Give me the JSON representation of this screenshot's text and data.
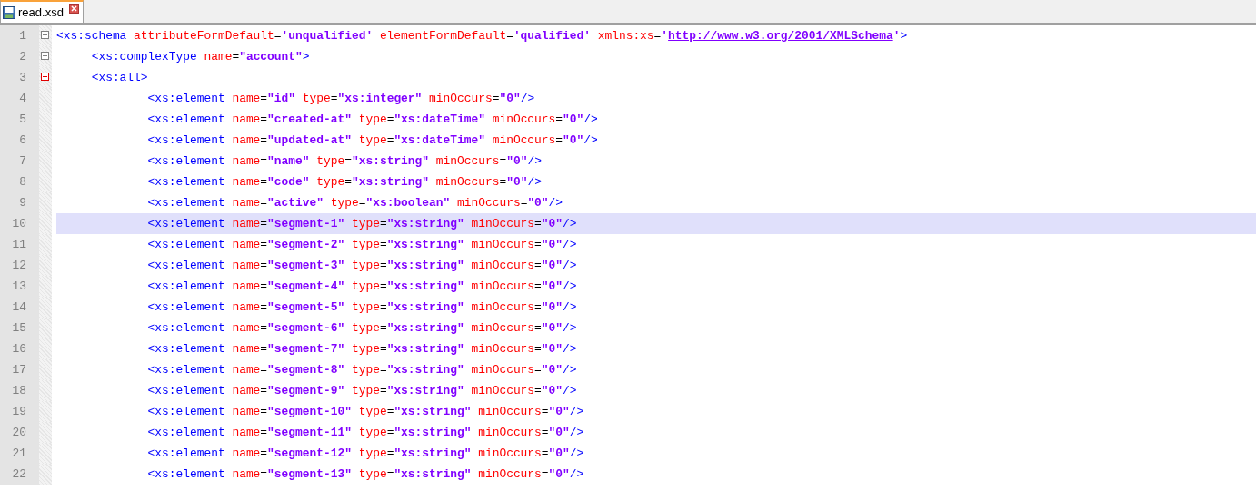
{
  "tabs": [
    {
      "label": "read.xsd",
      "selected": true
    }
  ],
  "lines": [
    {
      "number": "1",
      "kind": "fold_open",
      "selected": false,
      "tokens": [
        {
          "kind": "tag",
          "text": "<xs:schema "
        },
        {
          "kind": "attr",
          "text": "attributeFormDefault"
        },
        {
          "kind": "eq",
          "text": "="
        },
        {
          "kind": "value",
          "text": "'unqualified'"
        },
        {
          "kind": "attr",
          "text": " elementFormDefault"
        },
        {
          "kind": "eq",
          "text": "="
        },
        {
          "kind": "value",
          "text": "'qualified'"
        },
        {
          "kind": "attr",
          "text": " xmlns:xs"
        },
        {
          "kind": "eq",
          "text": "="
        },
        {
          "kind": "value",
          "text": "'"
        },
        {
          "kind": "link",
          "text": "http://www.w3.org/2001/XMLSchema"
        },
        {
          "kind": "value",
          "text": "'"
        },
        {
          "kind": "tag",
          "text": ">"
        }
      ]
    },
    {
      "number": "2",
      "kind": "fold_open",
      "selected": false,
      "tokens": [
        {
          "kind": "tag",
          "text": "     <xs:complexType "
        },
        {
          "kind": "attr",
          "text": "name"
        },
        {
          "kind": "eq",
          "text": "="
        },
        {
          "kind": "value",
          "text": "\"account\""
        },
        {
          "kind": "tag",
          "text": ">"
        }
      ]
    },
    {
      "number": "3",
      "kind": "fold_open_active",
      "selected": false,
      "tokens": [
        {
          "kind": "tag",
          "text": "     <xs:all>"
        }
      ]
    },
    {
      "number": "4",
      "kind": "fold_body",
      "selected": false,
      "tokens": [
        {
          "kind": "tag",
          "text": "             <xs:element "
        },
        {
          "kind": "attr",
          "text": "name"
        },
        {
          "kind": "eq",
          "text": "="
        },
        {
          "kind": "value",
          "text": "\"id\""
        },
        {
          "kind": "attr",
          "text": " type"
        },
        {
          "kind": "eq",
          "text": "="
        },
        {
          "kind": "value",
          "text": "\"xs:integer\""
        },
        {
          "kind": "attr",
          "text": " minOccurs"
        },
        {
          "kind": "eq",
          "text": "="
        },
        {
          "kind": "value",
          "text": "\"0\""
        },
        {
          "kind": "tag",
          "text": "/>"
        }
      ]
    },
    {
      "number": "5",
      "kind": "fold_body",
      "selected": false,
      "tokens": [
        {
          "kind": "tag",
          "text": "             <xs:element "
        },
        {
          "kind": "attr",
          "text": "name"
        },
        {
          "kind": "eq",
          "text": "="
        },
        {
          "kind": "value",
          "text": "\"created-at\""
        },
        {
          "kind": "attr",
          "text": " type"
        },
        {
          "kind": "eq",
          "text": "="
        },
        {
          "kind": "value",
          "text": "\"xs:dateTime\""
        },
        {
          "kind": "attr",
          "text": " minOccurs"
        },
        {
          "kind": "eq",
          "text": "="
        },
        {
          "kind": "value",
          "text": "\"0\""
        },
        {
          "kind": "tag",
          "text": "/>"
        }
      ]
    },
    {
      "number": "6",
      "kind": "fold_body",
      "selected": false,
      "tokens": [
        {
          "kind": "tag",
          "text": "             <xs:element "
        },
        {
          "kind": "attr",
          "text": "name"
        },
        {
          "kind": "eq",
          "text": "="
        },
        {
          "kind": "value",
          "text": "\"updated-at\""
        },
        {
          "kind": "attr",
          "text": " type"
        },
        {
          "kind": "eq",
          "text": "="
        },
        {
          "kind": "value",
          "text": "\"xs:dateTime\""
        },
        {
          "kind": "attr",
          "text": " minOccurs"
        },
        {
          "kind": "eq",
          "text": "="
        },
        {
          "kind": "value",
          "text": "\"0\""
        },
        {
          "kind": "tag",
          "text": "/>"
        }
      ]
    },
    {
      "number": "7",
      "kind": "fold_body",
      "selected": false,
      "tokens": [
        {
          "kind": "tag",
          "text": "             <xs:element "
        },
        {
          "kind": "attr",
          "text": "name"
        },
        {
          "kind": "eq",
          "text": "="
        },
        {
          "kind": "value",
          "text": "\"name\""
        },
        {
          "kind": "attr",
          "text": " type"
        },
        {
          "kind": "eq",
          "text": "="
        },
        {
          "kind": "value",
          "text": "\"xs:string\""
        },
        {
          "kind": "attr",
          "text": " minOccurs"
        },
        {
          "kind": "eq",
          "text": "="
        },
        {
          "kind": "value",
          "text": "\"0\""
        },
        {
          "kind": "tag",
          "text": "/>"
        }
      ]
    },
    {
      "number": "8",
      "kind": "fold_body",
      "selected": false,
      "tokens": [
        {
          "kind": "tag",
          "text": "             <xs:element "
        },
        {
          "kind": "attr",
          "text": "name"
        },
        {
          "kind": "eq",
          "text": "="
        },
        {
          "kind": "value",
          "text": "\"code\""
        },
        {
          "kind": "attr",
          "text": " type"
        },
        {
          "kind": "eq",
          "text": "="
        },
        {
          "kind": "value",
          "text": "\"xs:string\""
        },
        {
          "kind": "attr",
          "text": " minOccurs"
        },
        {
          "kind": "eq",
          "text": "="
        },
        {
          "kind": "value",
          "text": "\"0\""
        },
        {
          "kind": "tag",
          "text": "/>"
        }
      ]
    },
    {
      "number": "9",
      "kind": "fold_body",
      "selected": false,
      "tokens": [
        {
          "kind": "tag",
          "text": "             <xs:element "
        },
        {
          "kind": "attr",
          "text": "name"
        },
        {
          "kind": "eq",
          "text": "="
        },
        {
          "kind": "value",
          "text": "\"active\""
        },
        {
          "kind": "attr",
          "text": " type"
        },
        {
          "kind": "eq",
          "text": "="
        },
        {
          "kind": "value",
          "text": "\"xs:boolean\""
        },
        {
          "kind": "attr",
          "text": " minOccurs"
        },
        {
          "kind": "eq",
          "text": "="
        },
        {
          "kind": "value",
          "text": "\"0\""
        },
        {
          "kind": "tag",
          "text": "/>"
        }
      ]
    },
    {
      "number": "10",
      "kind": "fold_body",
      "selected": true,
      "tokens": [
        {
          "kind": "tag",
          "text": "             <xs:element "
        },
        {
          "kind": "attr",
          "text": "name"
        },
        {
          "kind": "eq",
          "text": "="
        },
        {
          "kind": "value",
          "text": "\"segment-1\""
        },
        {
          "kind": "attr",
          "text": " type"
        },
        {
          "kind": "eq",
          "text": "="
        },
        {
          "kind": "value",
          "text": "\"xs:string\""
        },
        {
          "kind": "attr",
          "text": " minOccurs"
        },
        {
          "kind": "eq",
          "text": "="
        },
        {
          "kind": "value",
          "text": "\"0\""
        },
        {
          "kind": "tag",
          "text": "/>"
        }
      ]
    },
    {
      "number": "11",
      "kind": "fold_body",
      "selected": false,
      "tokens": [
        {
          "kind": "tag",
          "text": "             <xs:element "
        },
        {
          "kind": "attr",
          "text": "name"
        },
        {
          "kind": "eq",
          "text": "="
        },
        {
          "kind": "value",
          "text": "\"segment-2\""
        },
        {
          "kind": "attr",
          "text": " type"
        },
        {
          "kind": "eq",
          "text": "="
        },
        {
          "kind": "value",
          "text": "\"xs:string\""
        },
        {
          "kind": "attr",
          "text": " minOccurs"
        },
        {
          "kind": "eq",
          "text": "="
        },
        {
          "kind": "value",
          "text": "\"0\""
        },
        {
          "kind": "tag",
          "text": "/>"
        }
      ]
    },
    {
      "number": "12",
      "kind": "fold_body",
      "selected": false,
      "tokens": [
        {
          "kind": "tag",
          "text": "             <xs:element "
        },
        {
          "kind": "attr",
          "text": "name"
        },
        {
          "kind": "eq",
          "text": "="
        },
        {
          "kind": "value",
          "text": "\"segment-3\""
        },
        {
          "kind": "attr",
          "text": " type"
        },
        {
          "kind": "eq",
          "text": "="
        },
        {
          "kind": "value",
          "text": "\"xs:string\""
        },
        {
          "kind": "attr",
          "text": " minOccurs"
        },
        {
          "kind": "eq",
          "text": "="
        },
        {
          "kind": "value",
          "text": "\"0\""
        },
        {
          "kind": "tag",
          "text": "/>"
        }
      ]
    },
    {
      "number": "13",
      "kind": "fold_body",
      "selected": false,
      "tokens": [
        {
          "kind": "tag",
          "text": "             <xs:element "
        },
        {
          "kind": "attr",
          "text": "name"
        },
        {
          "kind": "eq",
          "text": "="
        },
        {
          "kind": "value",
          "text": "\"segment-4\""
        },
        {
          "kind": "attr",
          "text": " type"
        },
        {
          "kind": "eq",
          "text": "="
        },
        {
          "kind": "value",
          "text": "\"xs:string\""
        },
        {
          "kind": "attr",
          "text": " minOccurs"
        },
        {
          "kind": "eq",
          "text": "="
        },
        {
          "kind": "value",
          "text": "\"0\""
        },
        {
          "kind": "tag",
          "text": "/>"
        }
      ]
    },
    {
      "number": "14",
      "kind": "fold_body",
      "selected": false,
      "tokens": [
        {
          "kind": "tag",
          "text": "             <xs:element "
        },
        {
          "kind": "attr",
          "text": "name"
        },
        {
          "kind": "eq",
          "text": "="
        },
        {
          "kind": "value",
          "text": "\"segment-5\""
        },
        {
          "kind": "attr",
          "text": " type"
        },
        {
          "kind": "eq",
          "text": "="
        },
        {
          "kind": "value",
          "text": "\"xs:string\""
        },
        {
          "kind": "attr",
          "text": " minOccurs"
        },
        {
          "kind": "eq",
          "text": "="
        },
        {
          "kind": "value",
          "text": "\"0\""
        },
        {
          "kind": "tag",
          "text": "/>"
        }
      ]
    },
    {
      "number": "15",
      "kind": "fold_body",
      "selected": false,
      "tokens": [
        {
          "kind": "tag",
          "text": "             <xs:element "
        },
        {
          "kind": "attr",
          "text": "name"
        },
        {
          "kind": "eq",
          "text": "="
        },
        {
          "kind": "value",
          "text": "\"segment-6\""
        },
        {
          "kind": "attr",
          "text": " type"
        },
        {
          "kind": "eq",
          "text": "="
        },
        {
          "kind": "value",
          "text": "\"xs:string\""
        },
        {
          "kind": "attr",
          "text": " minOccurs"
        },
        {
          "kind": "eq",
          "text": "="
        },
        {
          "kind": "value",
          "text": "\"0\""
        },
        {
          "kind": "tag",
          "text": "/>"
        }
      ]
    },
    {
      "number": "16",
      "kind": "fold_body",
      "selected": false,
      "tokens": [
        {
          "kind": "tag",
          "text": "             <xs:element "
        },
        {
          "kind": "attr",
          "text": "name"
        },
        {
          "kind": "eq",
          "text": "="
        },
        {
          "kind": "value",
          "text": "\"segment-7\""
        },
        {
          "kind": "attr",
          "text": " type"
        },
        {
          "kind": "eq",
          "text": "="
        },
        {
          "kind": "value",
          "text": "\"xs:string\""
        },
        {
          "kind": "attr",
          "text": " minOccurs"
        },
        {
          "kind": "eq",
          "text": "="
        },
        {
          "kind": "value",
          "text": "\"0\""
        },
        {
          "kind": "tag",
          "text": "/>"
        }
      ]
    },
    {
      "number": "17",
      "kind": "fold_body",
      "selected": false,
      "tokens": [
        {
          "kind": "tag",
          "text": "             <xs:element "
        },
        {
          "kind": "attr",
          "text": "name"
        },
        {
          "kind": "eq",
          "text": "="
        },
        {
          "kind": "value",
          "text": "\"segment-8\""
        },
        {
          "kind": "attr",
          "text": " type"
        },
        {
          "kind": "eq",
          "text": "="
        },
        {
          "kind": "value",
          "text": "\"xs:string\""
        },
        {
          "kind": "attr",
          "text": " minOccurs"
        },
        {
          "kind": "eq",
          "text": "="
        },
        {
          "kind": "value",
          "text": "\"0\""
        },
        {
          "kind": "tag",
          "text": "/>"
        }
      ]
    },
    {
      "number": "18",
      "kind": "fold_body",
      "selected": false,
      "tokens": [
        {
          "kind": "tag",
          "text": "             <xs:element "
        },
        {
          "kind": "attr",
          "text": "name"
        },
        {
          "kind": "eq",
          "text": "="
        },
        {
          "kind": "value",
          "text": "\"segment-9\""
        },
        {
          "kind": "attr",
          "text": " type"
        },
        {
          "kind": "eq",
          "text": "="
        },
        {
          "kind": "value",
          "text": "\"xs:string\""
        },
        {
          "kind": "attr",
          "text": " minOccurs"
        },
        {
          "kind": "eq",
          "text": "="
        },
        {
          "kind": "value",
          "text": "\"0\""
        },
        {
          "kind": "tag",
          "text": "/>"
        }
      ]
    },
    {
      "number": "19",
      "kind": "fold_body",
      "selected": false,
      "tokens": [
        {
          "kind": "tag",
          "text": "             <xs:element "
        },
        {
          "kind": "attr",
          "text": "name"
        },
        {
          "kind": "eq",
          "text": "="
        },
        {
          "kind": "value",
          "text": "\"segment-10\""
        },
        {
          "kind": "attr",
          "text": " type"
        },
        {
          "kind": "eq",
          "text": "="
        },
        {
          "kind": "value",
          "text": "\"xs:string\""
        },
        {
          "kind": "attr",
          "text": " minOccurs"
        },
        {
          "kind": "eq",
          "text": "="
        },
        {
          "kind": "value",
          "text": "\"0\""
        },
        {
          "kind": "tag",
          "text": "/>"
        }
      ]
    },
    {
      "number": "20",
      "kind": "fold_body",
      "selected": false,
      "tokens": [
        {
          "kind": "tag",
          "text": "             <xs:element "
        },
        {
          "kind": "attr",
          "text": "name"
        },
        {
          "kind": "eq",
          "text": "="
        },
        {
          "kind": "value",
          "text": "\"segment-11\""
        },
        {
          "kind": "attr",
          "text": " type"
        },
        {
          "kind": "eq",
          "text": "="
        },
        {
          "kind": "value",
          "text": "\"xs:string\""
        },
        {
          "kind": "attr",
          "text": " minOccurs"
        },
        {
          "kind": "eq",
          "text": "="
        },
        {
          "kind": "value",
          "text": "\"0\""
        },
        {
          "kind": "tag",
          "text": "/>"
        }
      ]
    },
    {
      "number": "21",
      "kind": "fold_body",
      "selected": false,
      "tokens": [
        {
          "kind": "tag",
          "text": "             <xs:element "
        },
        {
          "kind": "attr",
          "text": "name"
        },
        {
          "kind": "eq",
          "text": "="
        },
        {
          "kind": "value",
          "text": "\"segment-12\""
        },
        {
          "kind": "attr",
          "text": " type"
        },
        {
          "kind": "eq",
          "text": "="
        },
        {
          "kind": "value",
          "text": "\"xs:string\""
        },
        {
          "kind": "attr",
          "text": " minOccurs"
        },
        {
          "kind": "eq",
          "text": "="
        },
        {
          "kind": "value",
          "text": "\"0\""
        },
        {
          "kind": "tag",
          "text": "/>"
        }
      ]
    },
    {
      "number": "22",
      "kind": "fold_body",
      "selected": false,
      "tokens": [
        {
          "kind": "tag",
          "text": "             <xs:element "
        },
        {
          "kind": "attr",
          "text": "name"
        },
        {
          "kind": "eq",
          "text": "="
        },
        {
          "kind": "value",
          "text": "\"segment-13\""
        },
        {
          "kind": "attr",
          "text": " type"
        },
        {
          "kind": "eq",
          "text": "="
        },
        {
          "kind": "value",
          "text": "\"xs:string\""
        },
        {
          "kind": "attr",
          "text": " minOccurs"
        },
        {
          "kind": "eq",
          "text": "="
        },
        {
          "kind": "value",
          "text": "\"0\""
        },
        {
          "kind": "tag",
          "text": "/>"
        }
      ]
    }
  ]
}
